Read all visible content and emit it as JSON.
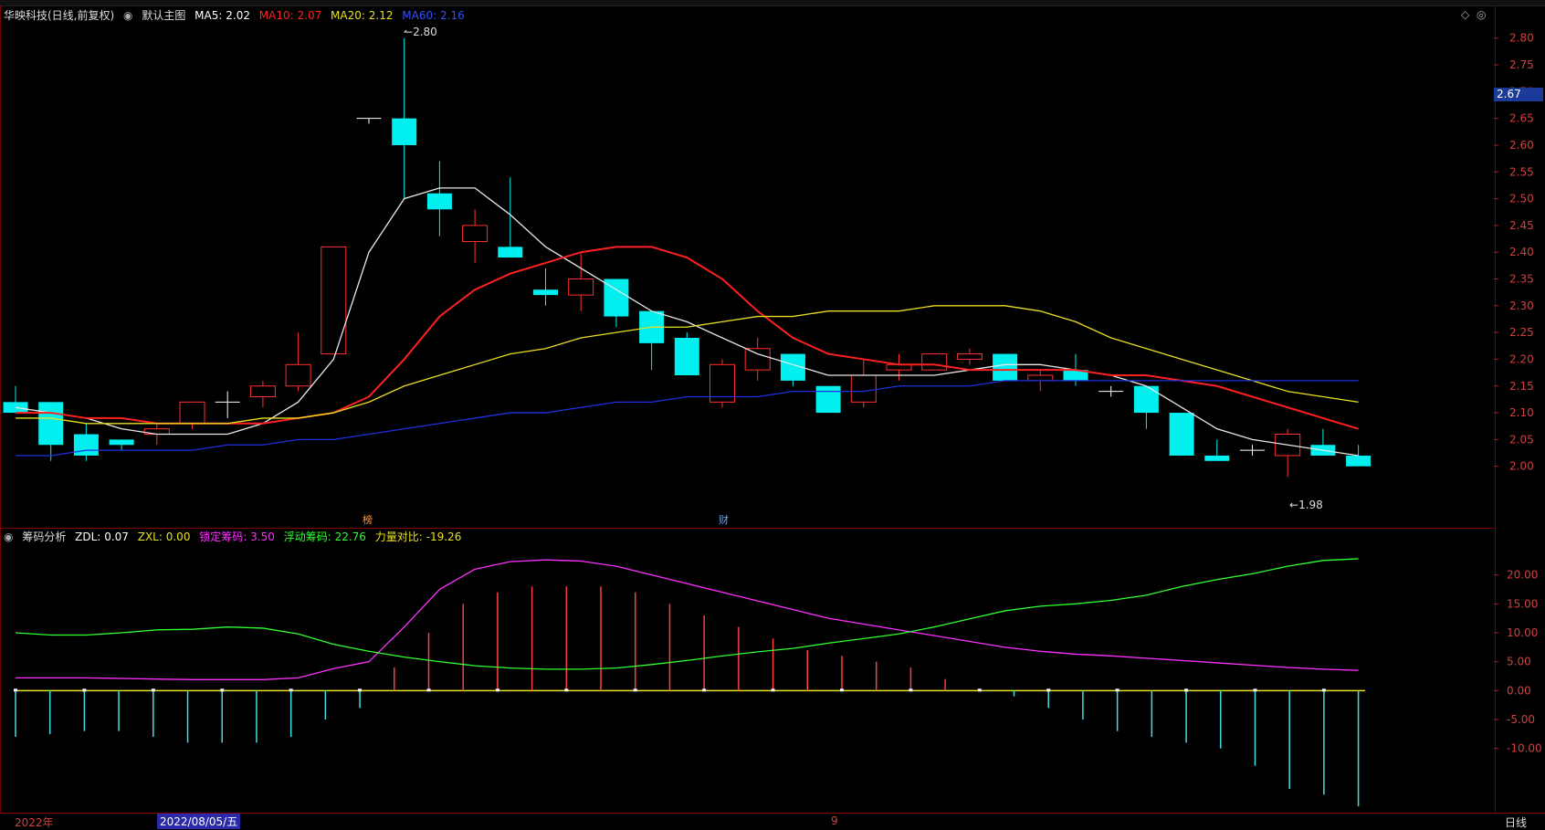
{
  "main_panel": {
    "stock_title": "华映科技(日线,前复权)",
    "indicator_name": "默认主图",
    "ma": [
      {
        "label": "MA5:",
        "value": "2.02",
        "color": "#ffffff"
      },
      {
        "label": "MA10:",
        "value": "2.07",
        "color": "#ff2020"
      },
      {
        "label": "MA20:",
        "value": "2.12",
        "color": "#e8e020"
      },
      {
        "label": "MA60:",
        "value": "2.16",
        "color": "#2040ff"
      }
    ],
    "high_mark": "2.80",
    "low_mark": "1.98",
    "current_price": "2.67",
    "event_tag_1": "榜",
    "event_tag_2": "财",
    "price_ticks": [
      "2.80",
      "2.75",
      "2.70",
      "2.65",
      "2.60",
      "2.55",
      "2.50",
      "2.45",
      "2.40",
      "2.35",
      "2.30",
      "2.25",
      "2.20",
      "2.15",
      "2.10",
      "2.05",
      "2.00"
    ]
  },
  "sub_panel": {
    "indicator_name": "筹码分析",
    "items": [
      {
        "label": "ZDL:",
        "value": "0.07",
        "color": "#ffffff"
      },
      {
        "label": "ZXL:",
        "value": "0.00",
        "color": "#e8e020"
      },
      {
        "label": "锁定筹码:",
        "value": "3.50",
        "color": "#ff30ff"
      },
      {
        "label": "浮动筹码:",
        "value": "22.76",
        "color": "#30ff30"
      },
      {
        "label": "力量对比:",
        "value": "-19.26",
        "color": "#e8e020"
      }
    ],
    "ticks": [
      "20.00",
      "15.00",
      "10.00",
      "5.00",
      "0.00",
      "-5.00",
      "-10.00"
    ]
  },
  "bottom_bar": {
    "year_label": "2022年",
    "date_label": "2022/08/05/五",
    "month_label": "9",
    "period_button": "日线"
  },
  "chart_data": [
    {
      "type": "candlestick",
      "title": "",
      "ylim": [
        1.95,
        2.82
      ],
      "candles": [
        {
          "o": 2.12,
          "h": 2.15,
          "l": 2.1,
          "c": 2.1
        },
        {
          "o": 2.12,
          "h": 2.12,
          "l": 2.01,
          "c": 2.04
        },
        {
          "o": 2.06,
          "h": 2.08,
          "l": 2.01,
          "c": 2.02
        },
        {
          "o": 2.05,
          "h": 2.05,
          "l": 2.03,
          "c": 2.04
        },
        {
          "o": 2.06,
          "h": 2.08,
          "l": 2.04,
          "c": 2.07
        },
        {
          "o": 2.08,
          "h": 2.12,
          "l": 2.07,
          "c": 2.12
        },
        {
          "o": 2.12,
          "h": 2.14,
          "l": 2.09,
          "c": 2.12
        },
        {
          "o": 2.13,
          "h": 2.16,
          "l": 2.11,
          "c": 2.15
        },
        {
          "o": 2.15,
          "h": 2.25,
          "l": 2.14,
          "c": 2.19
        },
        {
          "o": 2.21,
          "h": 2.41,
          "l": 2.21,
          "c": 2.41
        },
        {
          "o": 2.65,
          "h": 2.65,
          "l": 2.64,
          "c": 2.65
        },
        {
          "o": 2.65,
          "h": 2.8,
          "l": 2.5,
          "c": 2.6
        },
        {
          "o": 2.51,
          "h": 2.57,
          "l": 2.43,
          "c": 2.48
        },
        {
          "o": 2.42,
          "h": 2.48,
          "l": 2.38,
          "c": 2.45
        },
        {
          "o": 2.41,
          "h": 2.54,
          "l": 2.39,
          "c": 2.39
        },
        {
          "o": 2.33,
          "h": 2.37,
          "l": 2.3,
          "c": 2.32
        },
        {
          "o": 2.32,
          "h": 2.4,
          "l": 2.29,
          "c": 2.35
        },
        {
          "o": 2.35,
          "h": 2.35,
          "l": 2.26,
          "c": 2.28
        },
        {
          "o": 2.29,
          "h": 2.29,
          "l": 2.18,
          "c": 2.23
        },
        {
          "o": 2.24,
          "h": 2.25,
          "l": 2.17,
          "c": 2.17
        },
        {
          "o": 2.12,
          "h": 2.2,
          "l": 2.11,
          "c": 2.19
        },
        {
          "o": 2.18,
          "h": 2.24,
          "l": 2.16,
          "c": 2.22
        },
        {
          "o": 2.21,
          "h": 2.21,
          "l": 2.15,
          "c": 2.16
        },
        {
          "o": 2.15,
          "h": 2.15,
          "l": 2.1,
          "c": 2.1
        },
        {
          "o": 2.12,
          "h": 2.2,
          "l": 2.11,
          "c": 2.17
        },
        {
          "o": 2.18,
          "h": 2.21,
          "l": 2.16,
          "c": 2.19
        },
        {
          "o": 2.18,
          "h": 2.21,
          "l": 2.18,
          "c": 2.21
        },
        {
          "o": 2.2,
          "h": 2.22,
          "l": 2.19,
          "c": 2.21
        },
        {
          "o": 2.21,
          "h": 2.21,
          "l": 2.16,
          "c": 2.16
        },
        {
          "o": 2.16,
          "h": 2.18,
          "l": 2.14,
          "c": 2.17
        },
        {
          "o": 2.18,
          "h": 2.21,
          "l": 2.15,
          "c": 2.16
        },
        {
          "o": 2.14,
          "h": 2.15,
          "l": 2.13,
          "c": 2.14
        },
        {
          "o": 2.15,
          "h": 2.15,
          "l": 2.07,
          "c": 2.1
        },
        {
          "o": 2.1,
          "h": 2.1,
          "l": 2.02,
          "c": 2.02
        },
        {
          "o": 2.02,
          "h": 2.05,
          "l": 2.01,
          "c": 2.01
        },
        {
          "o": 2.03,
          "h": 2.04,
          "l": 2.02,
          "c": 2.03
        },
        {
          "o": 2.02,
          "h": 2.07,
          "l": 1.98,
          "c": 2.06
        },
        {
          "o": 2.04,
          "h": 2.07,
          "l": 2.02,
          "c": 2.02
        },
        {
          "o": 2.02,
          "h": 2.04,
          "l": 2.0,
          "c": 2.0
        }
      ],
      "series": [
        {
          "name": "MA5",
          "color": "#e8e8e8",
          "values": [
            2.11,
            2.1,
            2.09,
            2.07,
            2.06,
            2.06,
            2.06,
            2.08,
            2.12,
            2.2,
            2.4,
            2.5,
            2.52,
            2.52,
            2.47,
            2.41,
            2.37,
            2.33,
            2.29,
            2.27,
            2.24,
            2.21,
            2.19,
            2.17,
            2.17,
            2.17,
            2.17,
            2.18,
            2.19,
            2.19,
            2.18,
            2.17,
            2.15,
            2.11,
            2.07,
            2.05,
            2.04,
            2.03,
            2.02
          ]
        },
        {
          "name": "MA10",
          "color": "#ff2020",
          "values": [
            2.1,
            2.1,
            2.09,
            2.09,
            2.08,
            2.08,
            2.08,
            2.08,
            2.09,
            2.1,
            2.13,
            2.2,
            2.28,
            2.33,
            2.36,
            2.38,
            2.4,
            2.41,
            2.41,
            2.39,
            2.35,
            2.29,
            2.24,
            2.21,
            2.2,
            2.19,
            2.19,
            2.18,
            2.18,
            2.18,
            2.18,
            2.17,
            2.17,
            2.16,
            2.15,
            2.13,
            2.11,
            2.09,
            2.07
          ]
        },
        {
          "name": "MA20",
          "color": "#e8e020",
          "values": [
            2.09,
            2.09,
            2.08,
            2.08,
            2.08,
            2.08,
            2.08,
            2.09,
            2.09,
            2.1,
            2.12,
            2.15,
            2.17,
            2.19,
            2.21,
            2.22,
            2.24,
            2.25,
            2.26,
            2.26,
            2.27,
            2.28,
            2.28,
            2.29,
            2.29,
            2.29,
            2.3,
            2.3,
            2.3,
            2.29,
            2.27,
            2.24,
            2.22,
            2.2,
            2.18,
            2.16,
            2.14,
            2.13,
            2.12
          ]
        },
        {
          "name": "MA60",
          "color": "#2030e0",
          "values": [
            2.02,
            2.02,
            2.03,
            2.03,
            2.03,
            2.03,
            2.04,
            2.04,
            2.05,
            2.05,
            2.06,
            2.07,
            2.08,
            2.09,
            2.1,
            2.1,
            2.11,
            2.12,
            2.12,
            2.13,
            2.13,
            2.13,
            2.14,
            2.14,
            2.14,
            2.15,
            2.15,
            2.15,
            2.16,
            2.16,
            2.16,
            2.16,
            2.16,
            2.16,
            2.16,
            2.16,
            2.16,
            2.16,
            2.16
          ]
        }
      ]
    },
    {
      "type": "bar",
      "title": "",
      "ylim": [
        -20,
        25
      ],
      "values": [
        -8,
        -7.5,
        -7,
        -7,
        -8,
        -9,
        -9,
        -9,
        -8,
        -5,
        -3,
        4,
        10,
        15,
        17,
        18,
        18,
        18,
        17,
        15,
        13,
        11,
        9,
        7,
        6,
        5,
        4,
        2,
        0,
        -1,
        -3,
        -5,
        -7,
        -8,
        -9,
        -10,
        -13,
        -17,
        -18,
        -20
      ],
      "series": [
        {
          "name": "锁定筹码",
          "color": "#ff30ff",
          "values": [
            2.2,
            2.2,
            2.2,
            2.1,
            2.0,
            1.9,
            1.9,
            1.9,
            2.2,
            3.8,
            5.0,
            11.0,
            17.5,
            21.0,
            22.3,
            22.6,
            22.4,
            21.5,
            20.0,
            18.5,
            17.0,
            15.5,
            14.0,
            12.5,
            11.5,
            10.5,
            9.5,
            8.5,
            7.5,
            6.8,
            6.3,
            6.0,
            5.6,
            5.2,
            4.8,
            4.4,
            4.0,
            3.7,
            3.5
          ]
        },
        {
          "name": "浮动筹码",
          "color": "#30ff30",
          "values": [
            10.0,
            9.6,
            9.6,
            10.0,
            10.5,
            10.6,
            11.0,
            10.8,
            9.8,
            8.0,
            6.8,
            5.8,
            5.0,
            4.3,
            3.9,
            3.7,
            3.7,
            3.9,
            4.5,
            5.2,
            6.0,
            6.7,
            7.3,
            8.2,
            9.0,
            9.8,
            11.0,
            12.4,
            13.8,
            14.6,
            15.0,
            15.6,
            16.5,
            18.0,
            19.2,
            20.2,
            21.5,
            22.5,
            22.8
          ]
        }
      ]
    }
  ]
}
